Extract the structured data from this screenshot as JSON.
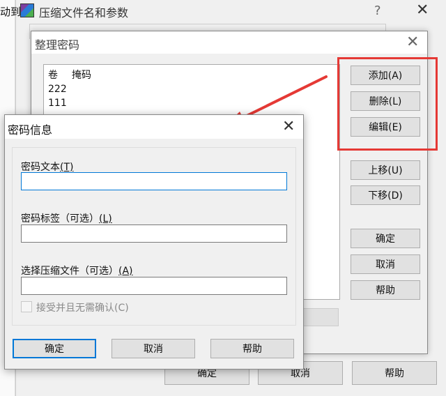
{
  "background_window": {
    "left_edge_text": "动到",
    "title": "压缩文件名和参数",
    "help_glyph": "?",
    "close_glyph": "✕",
    "buttons": {
      "ok": "确定",
      "cancel": "取消",
      "help": "帮助"
    }
  },
  "manage_dialog": {
    "title": "整理密码",
    "close_glyph": "✕",
    "list_headers": {
      "vol": "卷",
      "mask": "掩码"
    },
    "list_rows": [
      "222",
      "111"
    ],
    "buttons": {
      "add": "添加(A)",
      "delete": "删除(L)",
      "edit": "编辑(E)",
      "move_up": "上移(U)",
      "move_down": "下移(D)",
      "ok": "确定",
      "cancel": "取消",
      "help": "帮助"
    }
  },
  "password_dialog": {
    "title": "密码信息",
    "close_glyph": "✕",
    "password_label": "密码文本",
    "password_key": "(T)",
    "password_value": "",
    "tag_label": "密码标签（可选）",
    "tag_key": "(L)",
    "tag_value": "",
    "archive_label": "选择压缩文件（可选）",
    "archive_key": "(A)",
    "archive_value": "",
    "accept_label": "接受并且无需确认(C)",
    "buttons": {
      "ok": "确定",
      "cancel": "取消",
      "help": "帮助"
    }
  },
  "annotation": {
    "highlight_color": "#e53935",
    "arrow_color": "#e53935"
  }
}
